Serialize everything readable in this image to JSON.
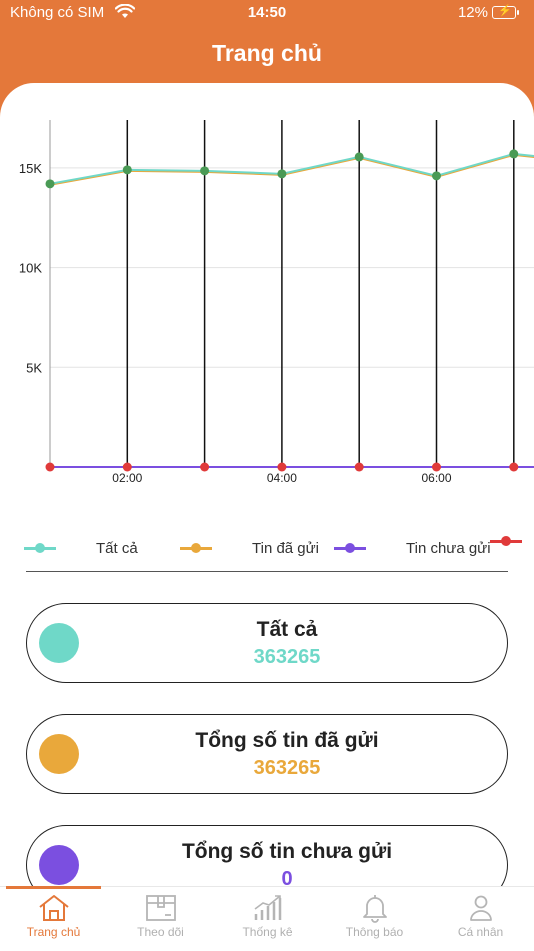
{
  "status_bar": {
    "carrier": "Không có SIM",
    "time": "14:50",
    "battery": "12%"
  },
  "header": {
    "title": "Trang chủ"
  },
  "chart_data": {
    "type": "line",
    "x": [
      "01:00",
      "02:00",
      "03:00",
      "04:00",
      "05:00",
      "06:00",
      "07:00",
      "08:00"
    ],
    "x_tick_labels": [
      "02:00",
      "04:00",
      "06:00"
    ],
    "y_tick_labels": [
      "5K",
      "10K",
      "15K"
    ],
    "ylim": [
      0,
      17400
    ],
    "series": [
      {
        "name": "Tất cả",
        "color": "#6FD8C8",
        "values": [
          14200,
          14900,
          14850,
          14700,
          15550,
          14600,
          15700,
          15300
        ]
      },
      {
        "name": "Tin đã gửi",
        "color": "#E9A83B",
        "values": [
          14150,
          14850,
          14800,
          14650,
          15500,
          14550,
          15650,
          15250
        ]
      },
      {
        "name": "Tin chưa gửi",
        "color": "#7B4FE0",
        "values": [
          0,
          0,
          0,
          0,
          0,
          0,
          0,
          0
        ]
      },
      {
        "color": "#E03A3A",
        "values": [
          0,
          0,
          0,
          0,
          0,
          0,
          0,
          0
        ]
      }
    ]
  },
  "legend": [
    {
      "label": "Tất cả",
      "color": "#6FD8C8"
    },
    {
      "label": "Tin đã gửi",
      "color": "#E9A83B"
    },
    {
      "label": "Tin chưa gửi",
      "color": "#7B4FE0"
    },
    {
      "label": "",
      "color": "#E03A3A"
    }
  ],
  "cards": [
    {
      "label": "Tất cả",
      "value": "363265",
      "color": "#6FD8C8"
    },
    {
      "label": "Tổng số tin đã gửi",
      "value": "363265",
      "color": "#E9A83B"
    },
    {
      "label": "Tổng số tin chưa gửi",
      "value": "0",
      "color": "#7B4FE0"
    }
  ],
  "tabs": [
    {
      "label": "Trang chủ",
      "icon": "home-icon",
      "active": true
    },
    {
      "label": "Theo dõi",
      "icon": "package-icon"
    },
    {
      "label": "Thống kê",
      "icon": "stats-icon"
    },
    {
      "label": "Thông báo",
      "icon": "bell-icon"
    },
    {
      "label": "Cá nhân",
      "icon": "person-icon"
    }
  ]
}
